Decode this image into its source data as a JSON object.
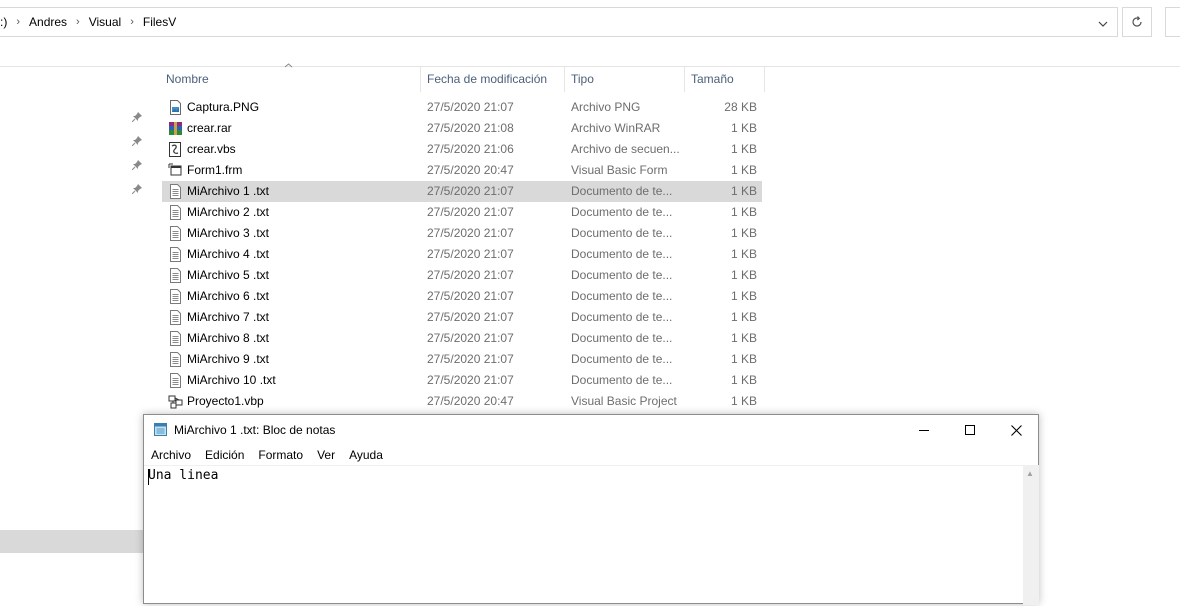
{
  "breadcrumb": {
    "drive_fragment": ":)",
    "items": [
      "Andres",
      "Visual",
      "FilesV"
    ],
    "separator": "›"
  },
  "columns": {
    "name": "Nombre",
    "date": "Fecha de modificación",
    "type": "Tipo",
    "size": "Tamaño"
  },
  "files": [
    {
      "name": "Captura.PNG",
      "date": "27/5/2020 21:07",
      "type": "Archivo PNG",
      "size": "28 KB",
      "icon": "png-file-icon"
    },
    {
      "name": "crear.rar",
      "date": "27/5/2020 21:08",
      "type": "Archivo WinRAR",
      "size": "1 KB",
      "icon": "winrar-file-icon"
    },
    {
      "name": "crear.vbs",
      "date": "27/5/2020 21:06",
      "type": "Archivo de secuen...",
      "size": "1 KB",
      "icon": "vbs-script-icon"
    },
    {
      "name": "Form1.frm",
      "date": "27/5/2020 20:47",
      "type": "Visual Basic Form",
      "size": "1 KB",
      "icon": "vb-form-icon"
    },
    {
      "name": "MiArchivo 1 .txt",
      "date": "27/5/2020 21:07",
      "type": "Documento de te...",
      "size": "1 KB",
      "icon": "text-file-icon",
      "selected": true
    },
    {
      "name": "MiArchivo 2 .txt",
      "date": "27/5/2020 21:07",
      "type": "Documento de te...",
      "size": "1 KB",
      "icon": "text-file-icon"
    },
    {
      "name": "MiArchivo 3 .txt",
      "date": "27/5/2020 21:07",
      "type": "Documento de te...",
      "size": "1 KB",
      "icon": "text-file-icon"
    },
    {
      "name": "MiArchivo 4 .txt",
      "date": "27/5/2020 21:07",
      "type": "Documento de te...",
      "size": "1 KB",
      "icon": "text-file-icon"
    },
    {
      "name": "MiArchivo 5 .txt",
      "date": "27/5/2020 21:07",
      "type": "Documento de te...",
      "size": "1 KB",
      "icon": "text-file-icon"
    },
    {
      "name": "MiArchivo 6 .txt",
      "date": "27/5/2020 21:07",
      "type": "Documento de te...",
      "size": "1 KB",
      "icon": "text-file-icon"
    },
    {
      "name": "MiArchivo 7 .txt",
      "date": "27/5/2020 21:07",
      "type": "Documento de te...",
      "size": "1 KB",
      "icon": "text-file-icon"
    },
    {
      "name": "MiArchivo 8 .txt",
      "date": "27/5/2020 21:07",
      "type": "Documento de te...",
      "size": "1 KB",
      "icon": "text-file-icon"
    },
    {
      "name": "MiArchivo 9 .txt",
      "date": "27/5/2020 21:07",
      "type": "Documento de te...",
      "size": "1 KB",
      "icon": "text-file-icon"
    },
    {
      "name": "MiArchivo 10 .txt",
      "date": "27/5/2020 21:07",
      "type": "Documento de te...",
      "size": "1 KB",
      "icon": "text-file-icon"
    },
    {
      "name": "Proyecto1.vbp",
      "date": "27/5/2020 20:47",
      "type": "Visual Basic Project",
      "size": "1 KB",
      "icon": "vb-project-icon"
    }
  ],
  "notepad": {
    "title": "MiArchivo 1 .txt: Bloc de notas",
    "menu": [
      "Archivo",
      "Edición",
      "Formato",
      "Ver",
      "Ayuda"
    ],
    "content": "Una linea",
    "controls": {
      "minimize": "minimize-icon",
      "maximize": "maximize-icon",
      "close": "close-icon"
    }
  },
  "colors": {
    "header_text": "#4c607a",
    "meta_text": "#6d6d6d",
    "selection": "#d9d9d9"
  }
}
